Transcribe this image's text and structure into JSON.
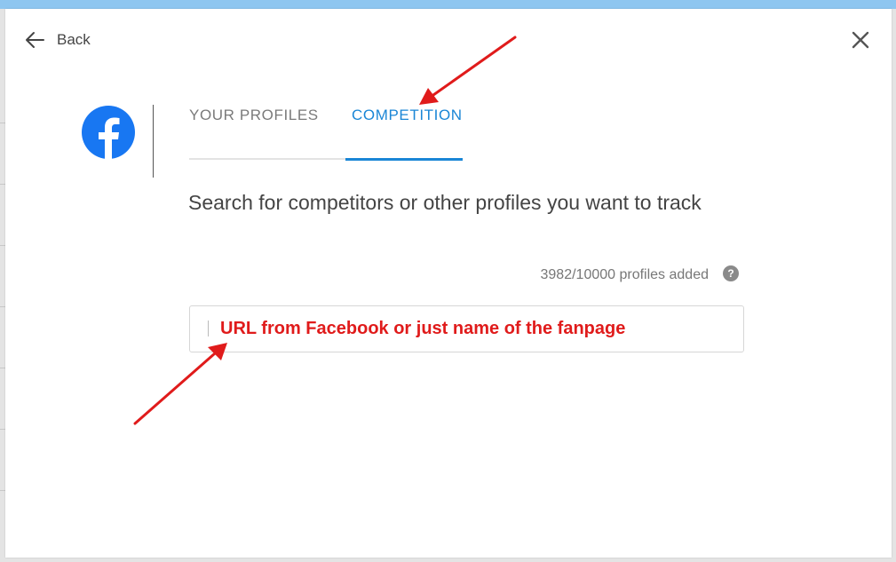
{
  "header": {
    "back_label": "Back"
  },
  "icons": {
    "back": "arrow-left-icon",
    "close": "close-icon",
    "logo": "facebook-logo-icon",
    "help": "question-circle-icon"
  },
  "tabs": [
    {
      "label": "YOUR PROFILES",
      "active": false
    },
    {
      "label": "COMPETITION",
      "active": true
    }
  ],
  "main": {
    "headline": "Search for competitors or other profiles you want to track",
    "profile_count": "3982/10000 profiles added",
    "help_glyph": "?"
  },
  "search": {
    "value": "",
    "placeholder": "URL from Facebook or just name of the fanpage"
  },
  "colors": {
    "accent": "#1a86d6",
    "facebook_blue": "#1877f2",
    "annotation_red": "#e01b1b"
  }
}
